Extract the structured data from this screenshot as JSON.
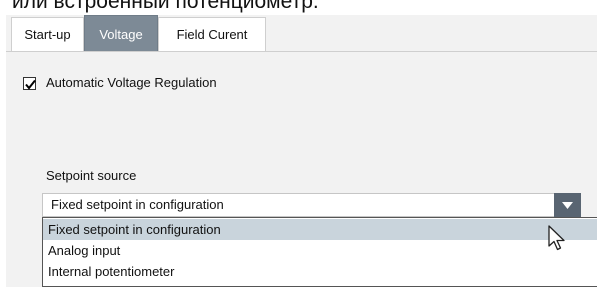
{
  "caption": "или встроенный потенциометр.",
  "tabs": [
    {
      "label": "Start-up",
      "active": false
    },
    {
      "label": "Voltage",
      "active": true
    },
    {
      "label": "Field Curent",
      "active": false
    }
  ],
  "avr": {
    "label": "Automatic Voltage Regulation",
    "checked": true
  },
  "setpoint": {
    "label": "Setpoint source",
    "selected": "Fixed setpoint in configuration",
    "options": [
      "Fixed setpoint in configuration",
      "Analog input",
      "Internal potentiometer"
    ]
  },
  "colors": {
    "active_tab": "#7d8a96",
    "highlight": "#c9d4dc",
    "arrow_button": "#596572",
    "panel_bg": "#f2f2f2"
  },
  "icons": {
    "dropdown": "chevron-down-icon",
    "checkbox": "check-icon",
    "cursor": "mouse-pointer-icon"
  }
}
